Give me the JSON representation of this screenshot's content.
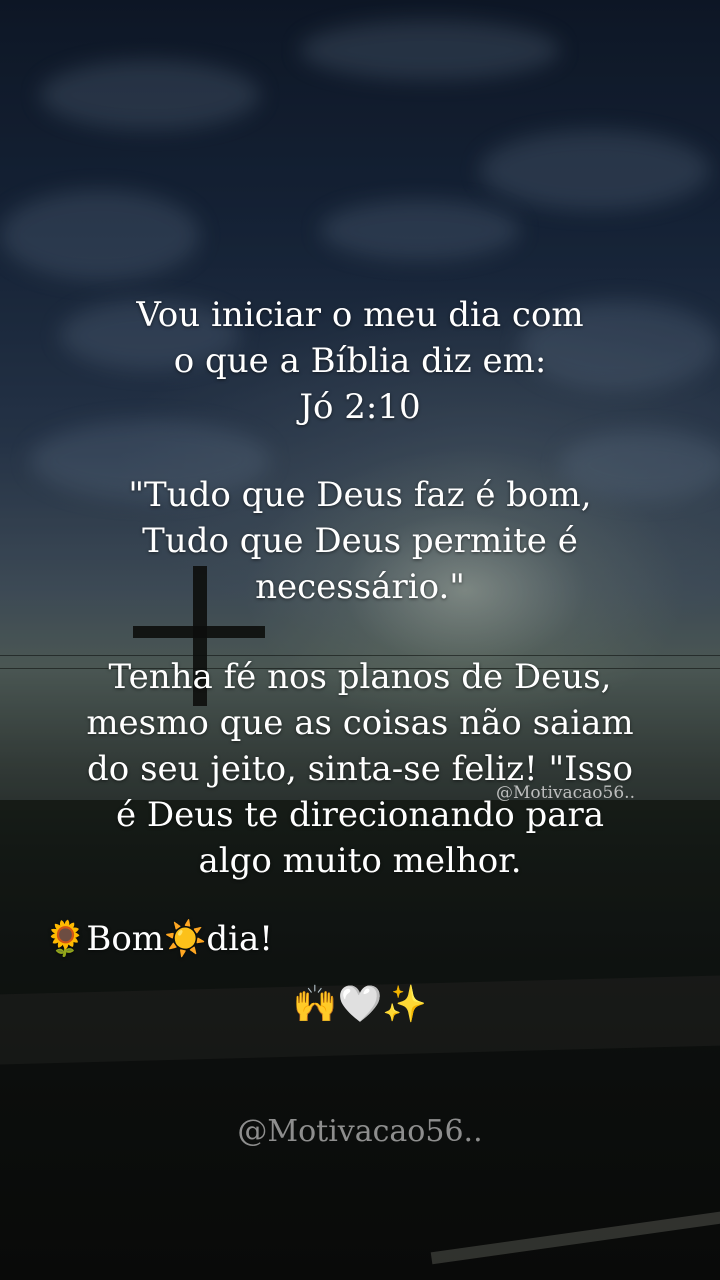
{
  "verse_intro": {
    "lines": [
      "Vou iniciar o meu dia com",
      "o que a Bíblia diz em:",
      "Jó 2:10"
    ]
  },
  "quote": {
    "lines": [
      "\"Tudo que Deus faz é bom,",
      "Tudo que Deus permite é",
      "necessário.\""
    ]
  },
  "message": {
    "lines": [
      "Tenha fé nos planos de Deus,",
      "mesmo que as coisas não saiam",
      "do seu jeito, sinta-se feliz! \"Isso",
      "é Deus te direcionando para",
      "algo muito melhor."
    ]
  },
  "greeting": {
    "sunflower": "🌻",
    "word1": "Bom",
    "sun": "☀️",
    "word2": "dia!"
  },
  "emojis": "🙌🤍✨",
  "watermark_small": "@Motivacao56..",
  "watermark": "@Motivacao56..",
  "colors": {
    "text": "#ffffff",
    "watermark": "#afafaf"
  },
  "icons": [
    "sunflower-icon",
    "sun-icon",
    "raised-hands-icon",
    "white-heart-icon",
    "sparkles-icon"
  ]
}
